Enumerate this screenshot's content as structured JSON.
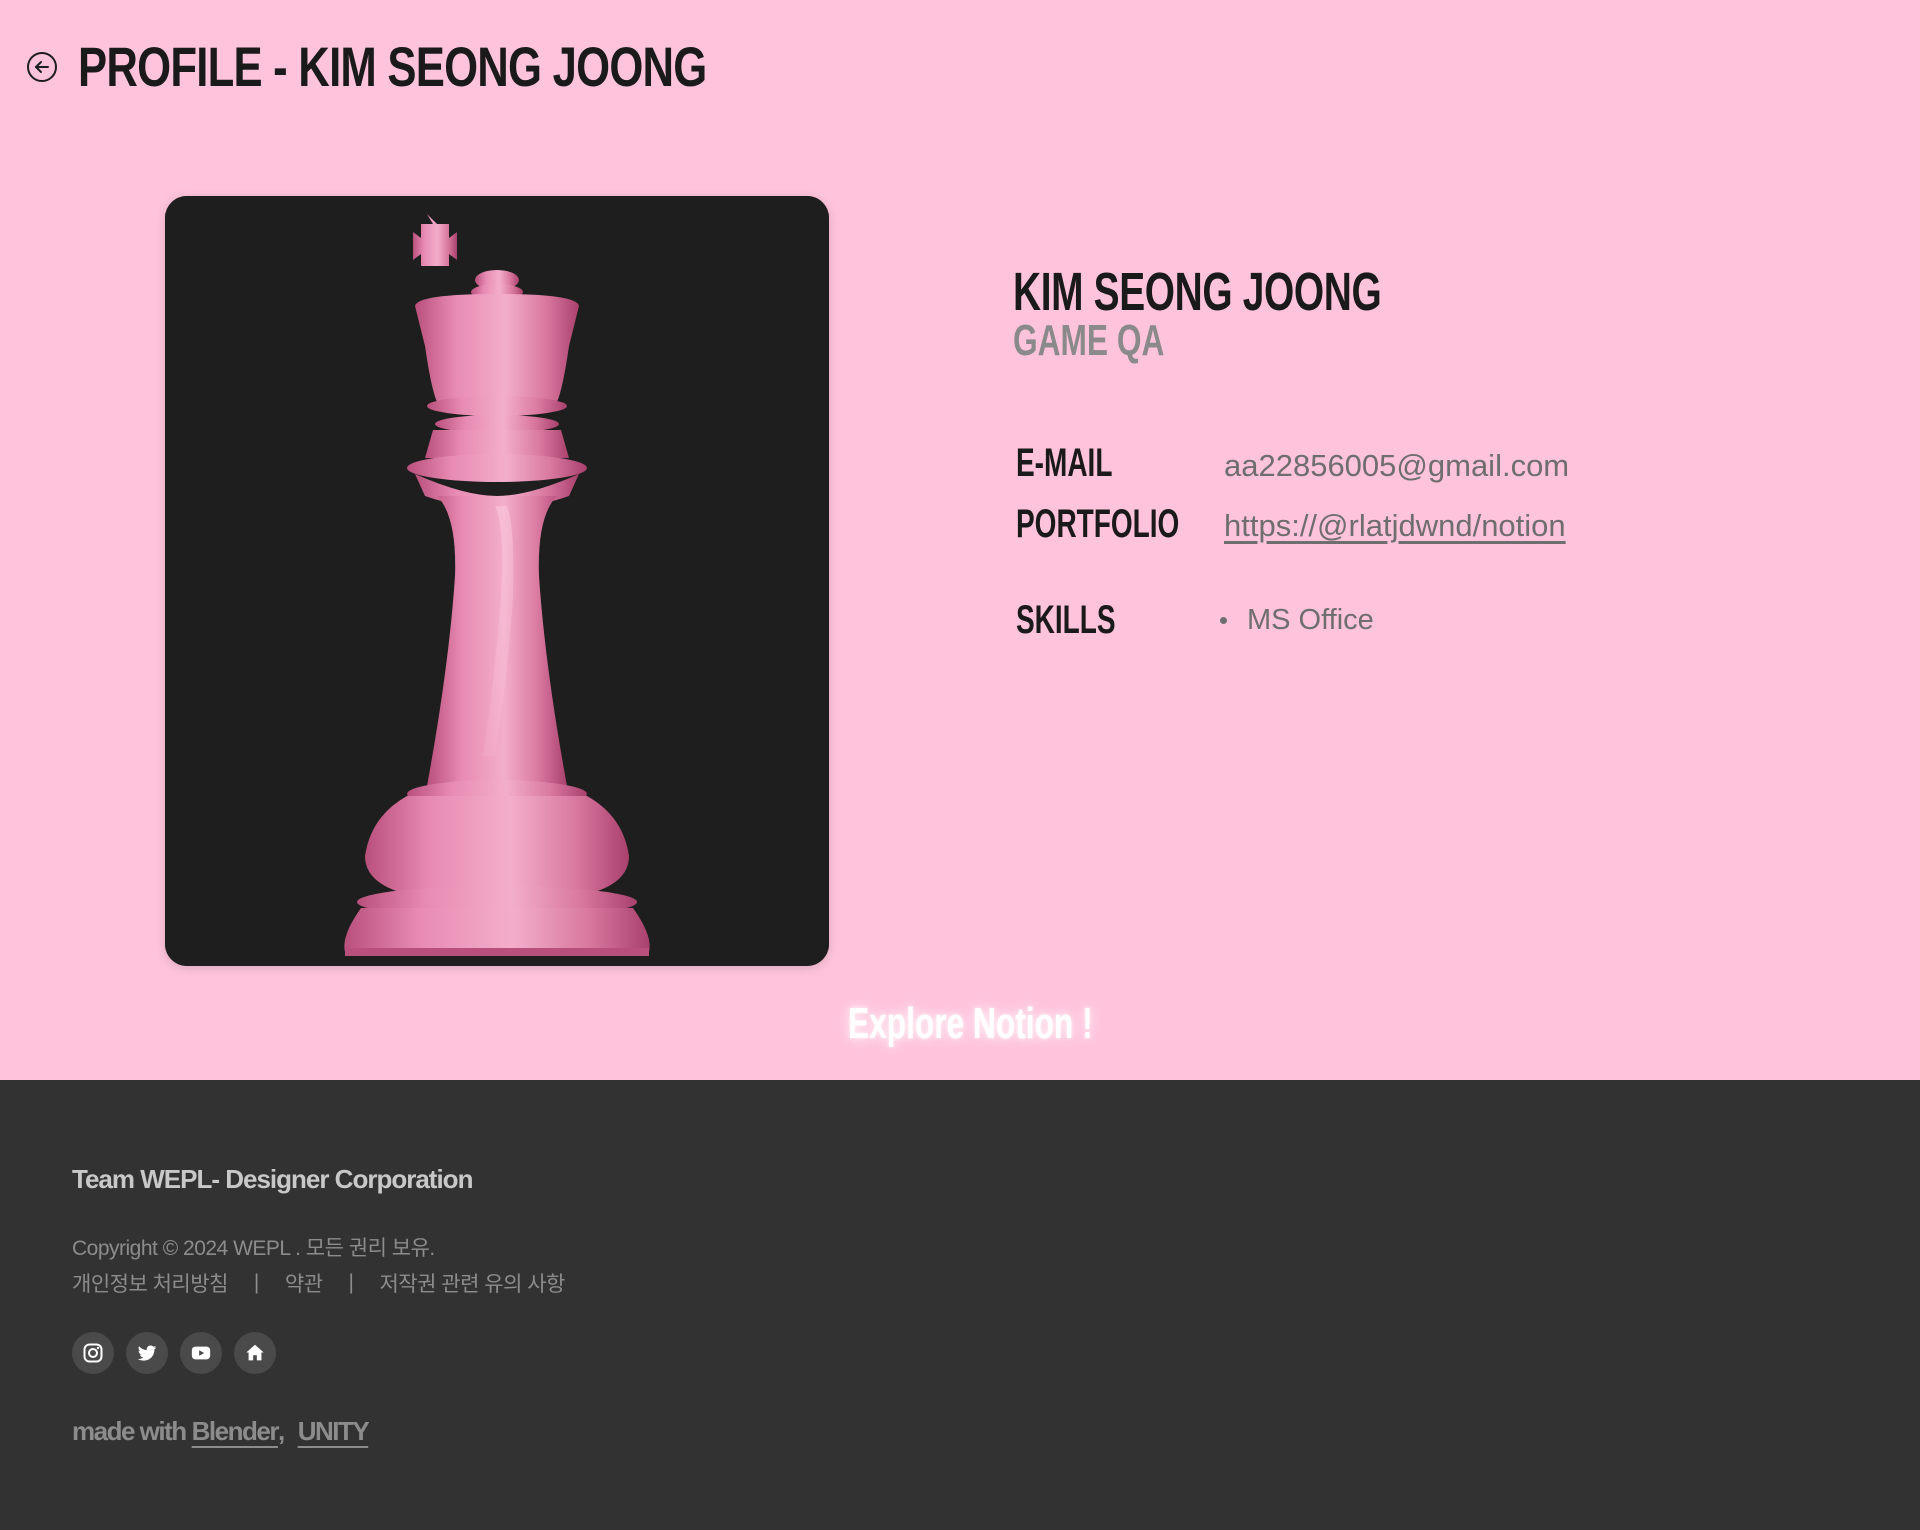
{
  "header": {
    "back_icon": "arrow-left-circle-icon",
    "title": "PROFILE - KIM SEONG JOONG"
  },
  "profile": {
    "image_subject": "pink chess king",
    "name": "KIM SEONG JOONG",
    "role": "GAME QA",
    "email_label": "E-MAIL",
    "email": "aa22856005@gmail.com",
    "portfolio_label": "PORTFOLIO",
    "portfolio": "https://@rlatjdwnd/notion",
    "skills_label": "SKILLS",
    "skills": [
      "MS Office"
    ]
  },
  "explore_label": "Explore Notion !",
  "footer": {
    "company": "Team WEPL- Designer Corporation",
    "copyright": "Copyright © 2024 WEPL . 모든 권리 보유.",
    "links": [
      "개인정보 처리방침",
      "약관",
      "저작권 관련 유의 사항"
    ],
    "separator": "|",
    "social_icons": [
      "instagram-icon",
      "twitter-icon",
      "youtube-icon",
      "home-icon"
    ],
    "made_with_prefix": "made with",
    "tools": [
      "Blender",
      "UNITY"
    ],
    "tools_separator": ","
  },
  "colors": {
    "page_bg": "#ffc4dc",
    "footer_bg": "#323232",
    "card_bg": "#1e1e1e",
    "chess_pink": "#e58aae"
  }
}
